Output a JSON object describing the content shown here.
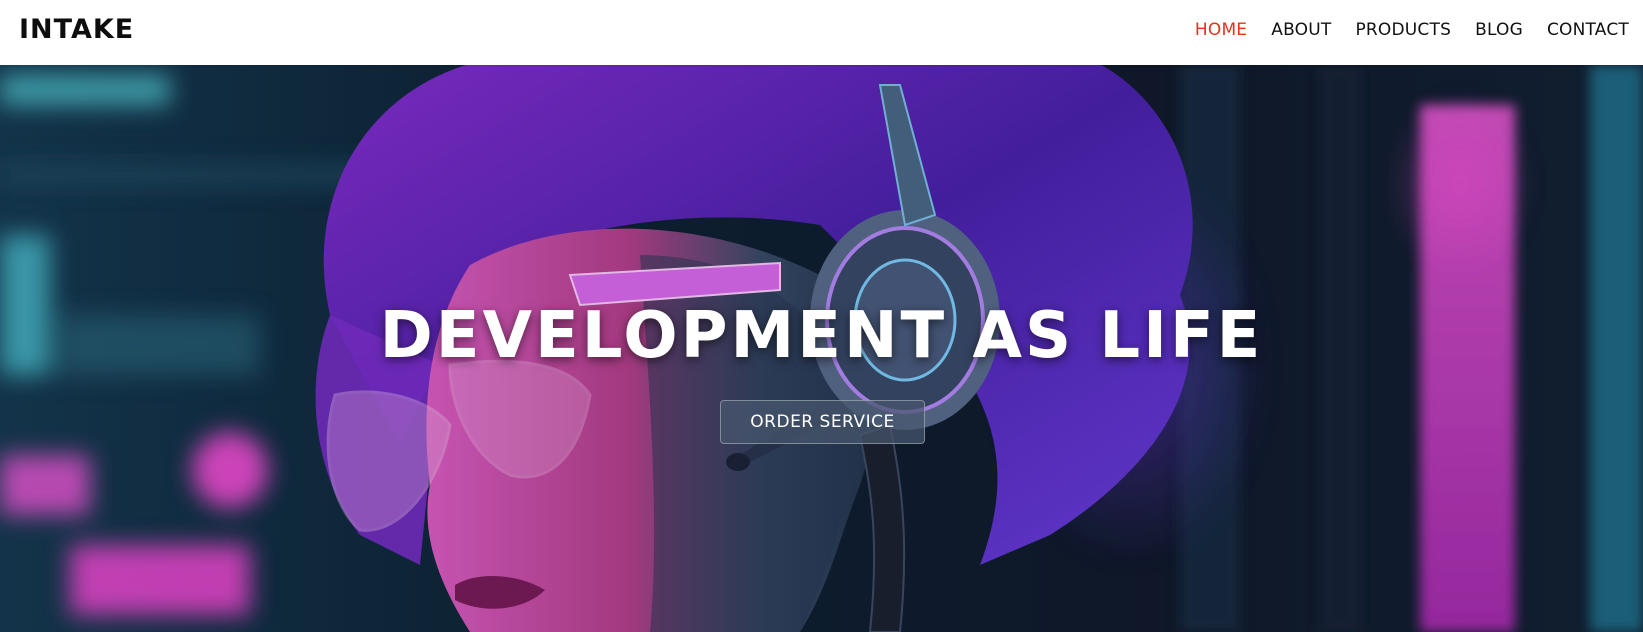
{
  "brand": {
    "logo_text": "INTAKE"
  },
  "nav": {
    "items": [
      {
        "label": "HOME",
        "active": true
      },
      {
        "label": "ABOUT",
        "active": false
      },
      {
        "label": "PRODUCTS",
        "active": false
      },
      {
        "label": "BLOG",
        "active": false
      },
      {
        "label": "CONTACT",
        "active": false
      }
    ]
  },
  "hero": {
    "title": "DEVELOPMENT AS LIFE",
    "cta_label": "ORDER SERVICE"
  },
  "colors": {
    "active_nav": "#e8311a",
    "nav_text": "#111111",
    "header_bg": "#ffffff",
    "hero_magenta": "#d63fd8",
    "hero_cyan": "#3fd3e0",
    "hero_violet": "#6a2fd0"
  },
  "hero_image": {
    "icon_name": "woman-with-headset-neon-illustration"
  }
}
